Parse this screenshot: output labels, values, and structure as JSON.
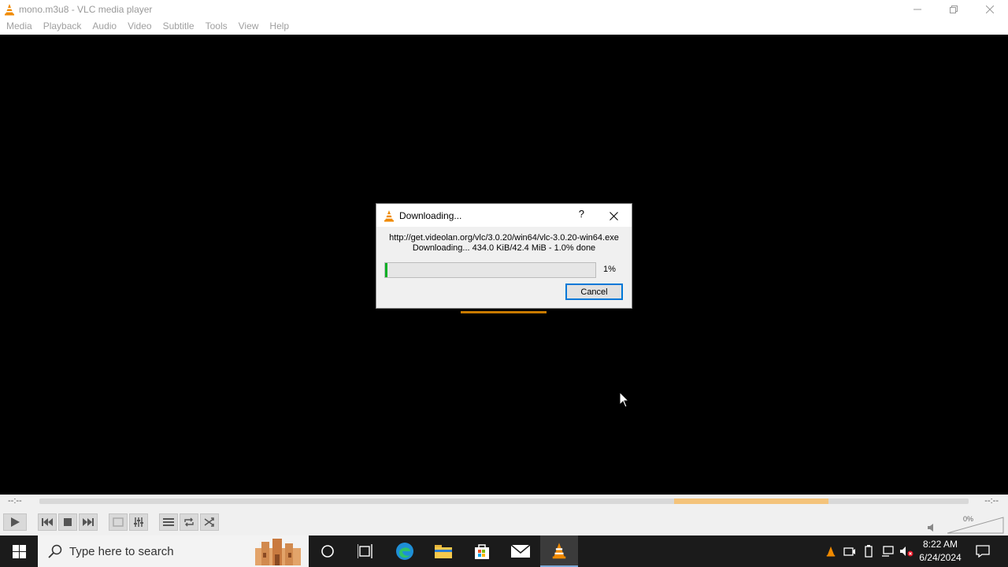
{
  "window": {
    "title": "mono.m3u8 - VLC media player",
    "icon": "vlc-cone-icon"
  },
  "menu": {
    "items": [
      "Media",
      "Playback",
      "Audio",
      "Video",
      "Subtitle",
      "Tools",
      "View",
      "Help"
    ]
  },
  "dialog": {
    "title": "Downloading...",
    "help_label": "?",
    "url": "http://get.videolan.org/vlc/3.0.20/win64/vlc-3.0.20-win64.exe",
    "status": "Downloading... 434.0 KiB/42.4 MiB - 1.0% done",
    "progress_percent": 1,
    "progress_label": "1%",
    "cancel_label": "Cancel"
  },
  "player": {
    "time_elapsed": "--:--",
    "time_total": "--:--",
    "volume_label": "0%"
  },
  "taskbar": {
    "search_placeholder": "Type here to search",
    "clock_time": "8:22 AM",
    "clock_date": "6/24/2024"
  },
  "colors": {
    "vlc_orange": "#f08a00",
    "progress_green": "#06b025",
    "accent_blue": "#0078d7",
    "taskbar_bg": "#1b1b1b"
  }
}
